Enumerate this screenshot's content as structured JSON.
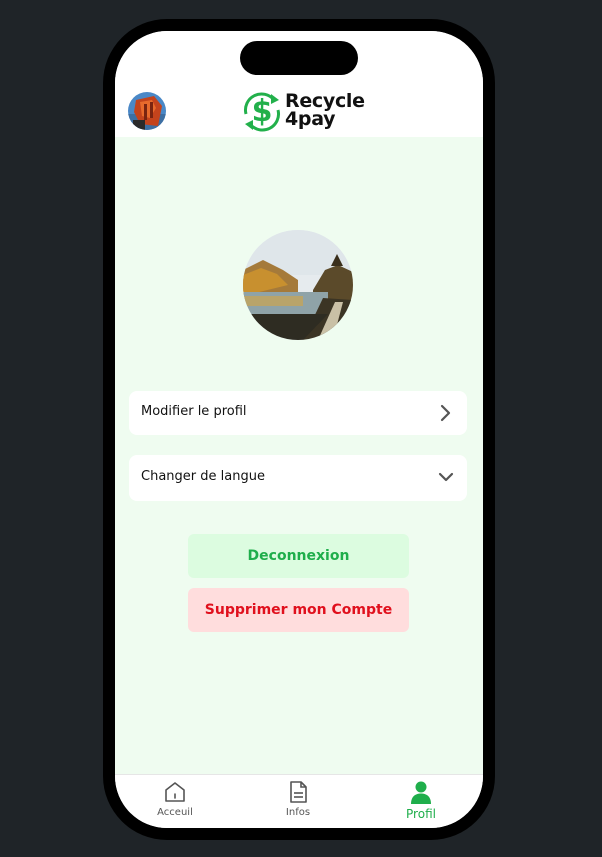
{
  "app": {
    "brand_line1": "Recycle",
    "brand_line2": "4pay"
  },
  "profile": {
    "edit_label": "Modifier le profil",
    "language_label": "Changer de langue",
    "logout_label": "Deconnexion",
    "delete_label": "Supprimer mon Compte"
  },
  "nav": {
    "items": [
      {
        "label": "Acceuil",
        "icon": "home-icon",
        "active": false
      },
      {
        "label": "Infos",
        "icon": "document-icon",
        "active": false
      },
      {
        "label": "Profil",
        "icon": "user-icon",
        "active": true
      }
    ]
  },
  "colors": {
    "accent": "#1fae4b",
    "danger": "#e0101d",
    "content_bg": "#effcf0",
    "logout_bg": "#dcfce0",
    "delete_bg": "#ffdddd"
  }
}
